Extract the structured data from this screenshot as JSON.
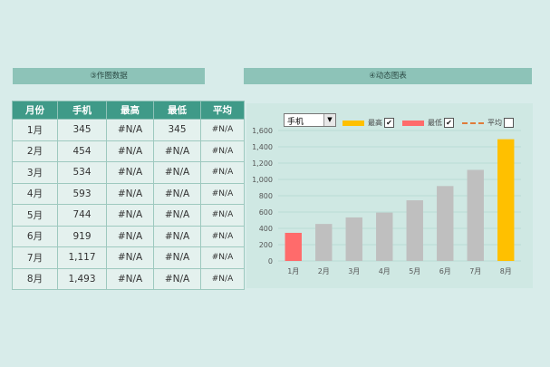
{
  "headers": {
    "left": "③作图数据",
    "right": "④动态图表"
  },
  "table": {
    "columns": [
      "月份",
      "手机",
      "最高",
      "最低",
      "平均"
    ],
    "rows": [
      [
        "1月",
        "345",
        "#N/A",
        "345",
        "#N/A"
      ],
      [
        "2月",
        "454",
        "#N/A",
        "#N/A",
        "#N/A"
      ],
      [
        "3月",
        "534",
        "#N/A",
        "#N/A",
        "#N/A"
      ],
      [
        "4月",
        "593",
        "#N/A",
        "#N/A",
        "#N/A"
      ],
      [
        "5月",
        "744",
        "#N/A",
        "#N/A",
        "#N/A"
      ],
      [
        "6月",
        "919",
        "#N/A",
        "#N/A",
        "#N/A"
      ],
      [
        "7月",
        "1,117",
        "#N/A",
        "#N/A",
        "#N/A"
      ],
      [
        "8月",
        "1,493",
        "#N/A",
        "#N/A",
        "#N/A"
      ]
    ]
  },
  "controls": {
    "product_select": "手机",
    "legend": [
      {
        "label": "最高",
        "checked": true,
        "color": "#ffc000",
        "icon": "solid-bar"
      },
      {
        "label": "最低",
        "checked": true,
        "color": "#ff6b6b",
        "icon": "solid-bar"
      },
      {
        "label": "平均",
        "checked": false,
        "color": "#e07b39",
        "icon": "dashed-line"
      }
    ],
    "check_mark": "✔"
  },
  "chart_data": {
    "type": "bar",
    "categories": [
      "1月",
      "2月",
      "3月",
      "4月",
      "5月",
      "6月",
      "7月",
      "8月"
    ],
    "values": [
      345,
      454,
      534,
      593,
      744,
      919,
      1117,
      1493
    ],
    "highlight": {
      "min_index": 0,
      "max_index": 7
    },
    "colors": {
      "normal": "#bfbfbf",
      "min": "#ff6b6b",
      "max": "#ffc000"
    },
    "ylim": [
      0,
      1600
    ],
    "yticks": [
      0,
      200,
      400,
      600,
      800,
      1000,
      1200,
      1400,
      1600
    ],
    "ytick_labels": [
      "0",
      "200",
      "400",
      "600",
      "800",
      "1,000",
      "1,200",
      "1,400",
      "1,600"
    ],
    "grid": true,
    "legend_position": "top"
  }
}
